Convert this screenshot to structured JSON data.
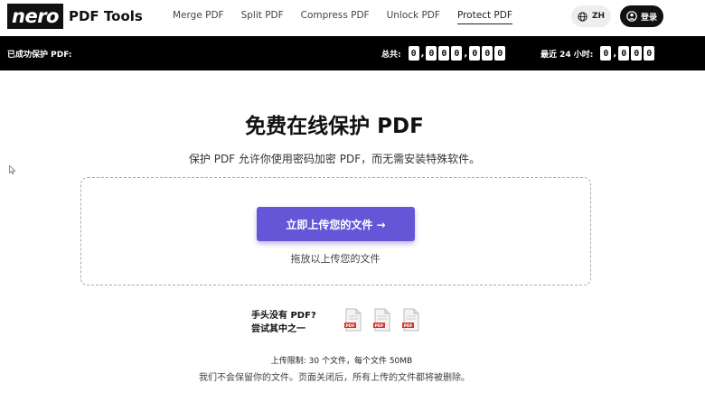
{
  "header": {
    "logo": "nero",
    "app_title": "PDF Tools",
    "nav": [
      {
        "label": "Merge PDF"
      },
      {
        "label": "Split PDF"
      },
      {
        "label": "Compress PDF"
      },
      {
        "label": "Unlock PDF"
      },
      {
        "label": "Protect PDF",
        "active": true
      }
    ],
    "lang_label": "ZH",
    "lang_icon": "globe-icon",
    "login_label": "登录",
    "login_icon": "user-icon"
  },
  "stats": {
    "label": "已成功保护 PDF:",
    "total_label": "总共:",
    "total_digits": [
      "0",
      ",",
      "0",
      "0",
      "0",
      ",",
      "0",
      "0",
      "0"
    ],
    "recent_label": "最近 24 小时:",
    "recent_digits": [
      "0",
      ",",
      "0",
      "0",
      "0"
    ]
  },
  "main": {
    "title": "免费在线保护 PDF",
    "subtitle": "保护 PDF 允许你使用密码加密 PDF，而无需安装特殊软件。",
    "upload_button": "立即上传您的文件 →",
    "drop_hint": "拖放以上传您的文件",
    "sample_line1": "手头没有 PDF?",
    "sample_line2": "尝试其中之一",
    "sample_icon": "pdf-file-icon",
    "upload_limit": "上传限制:  30 个文件，每个文件 50MB",
    "privacy_note": "我们不会保留你的文件。页面关闭后，所有上传的文件都将被删除。"
  },
  "colors": {
    "primary": "#6357d8",
    "bar": "#000000",
    "pdf_red": "#d9322b"
  }
}
